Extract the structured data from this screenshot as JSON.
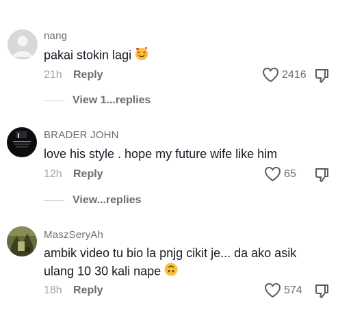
{
  "comments": [
    {
      "username": "nang",
      "text": "pakai stokin lagi",
      "emoji": "smiling-face-with-hearts",
      "time": "21h",
      "reply_label": "Reply",
      "like_count": "2416",
      "view_replies": "View 1...replies"
    },
    {
      "username": "BRADER JOHN",
      "text": "love his style . hope my future wife like him",
      "time": "12h",
      "reply_label": "Reply",
      "like_count": "65",
      "view_replies": "View...replies"
    },
    {
      "username": "MaszSeryAh",
      "text_line1": "ambik video tu bio la pnjg cikit je... da ako asik",
      "text_line2": "ulang 10 30 kali nape",
      "emoji": "upside-down-face",
      "time": "18h",
      "reply_label": "Reply",
      "like_count": "574"
    }
  ],
  "colors": {
    "primary_text": "#161823",
    "secondary_text": "#6b6b72",
    "muted_text": "#a3a3a8",
    "divider": "#c8c8cc"
  }
}
